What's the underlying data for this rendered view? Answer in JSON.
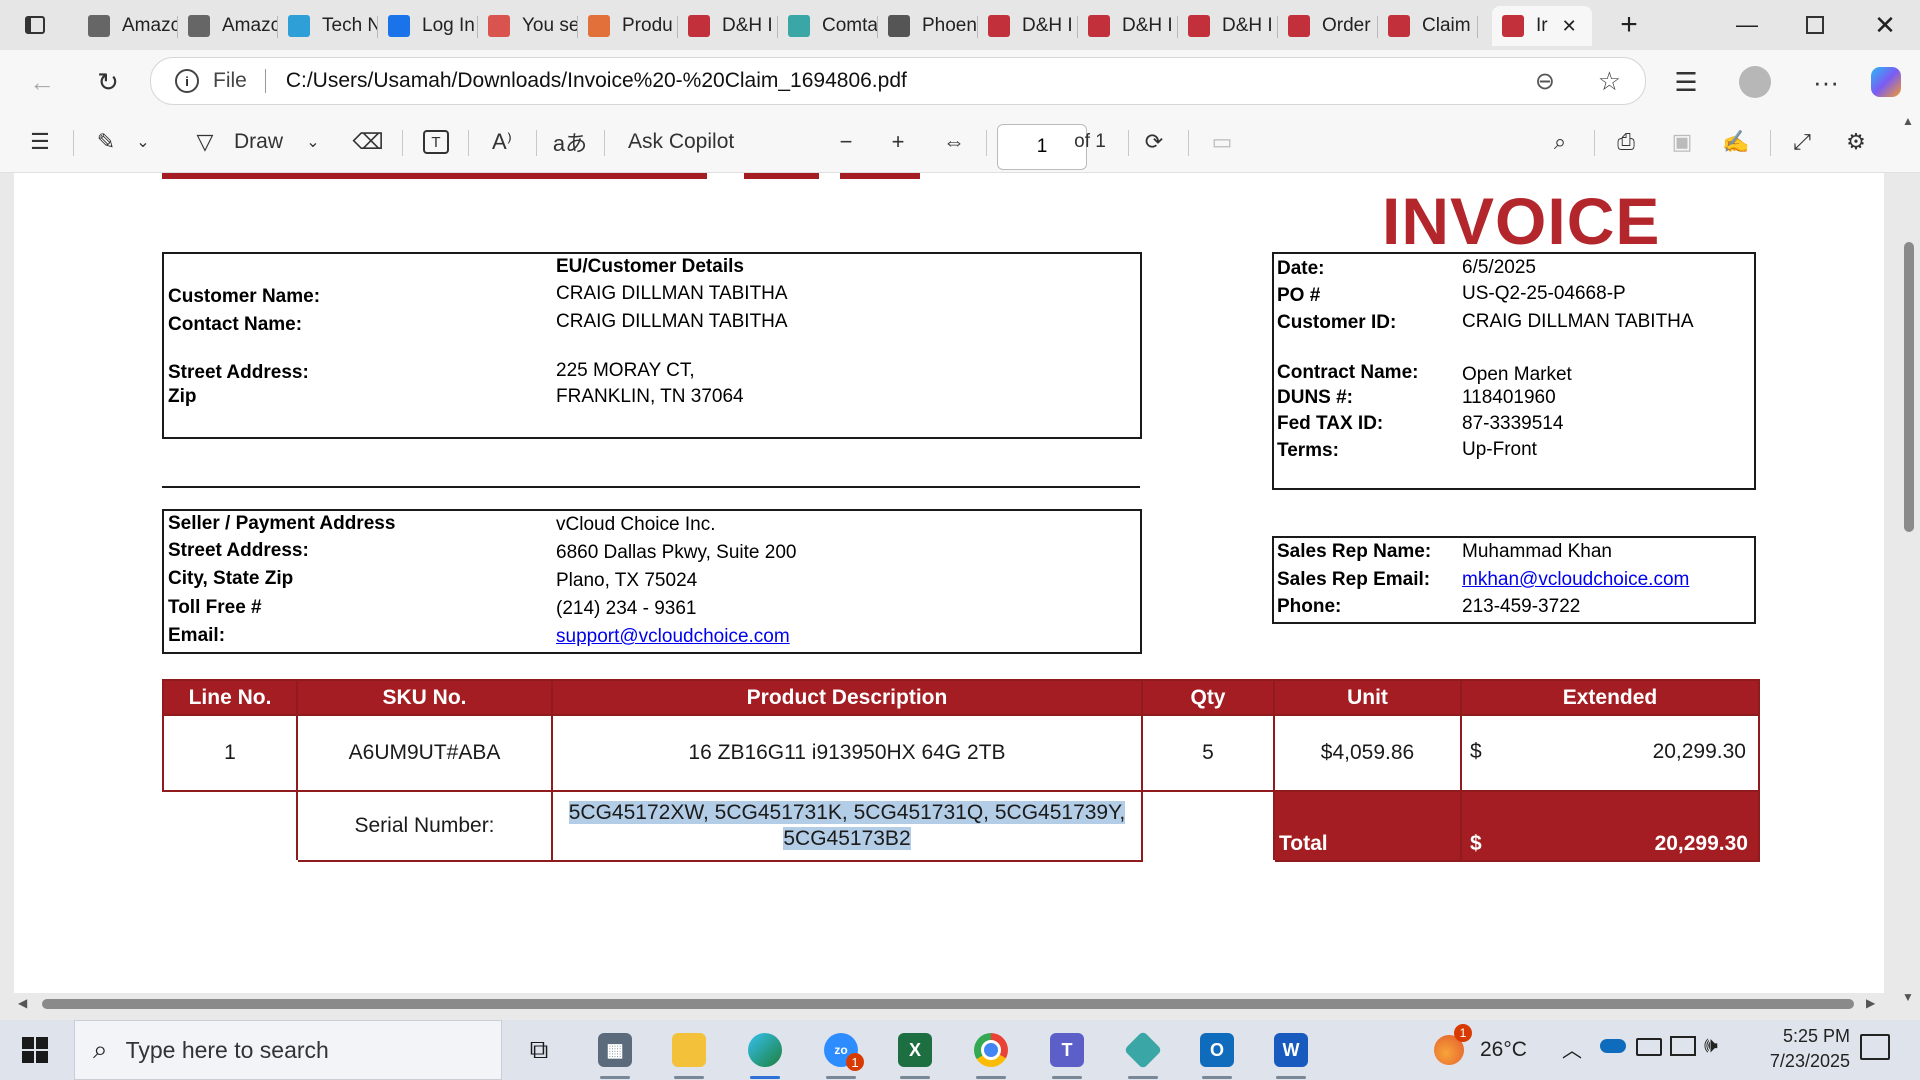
{
  "browser": {
    "tabs": [
      {
        "label": "Amazc",
        "icon": "amazon-icon",
        "color": "#666666"
      },
      {
        "label": "Amazc",
        "icon": "amazon-icon",
        "color": "#666666"
      },
      {
        "label": "Tech N",
        "icon": "ec-icon",
        "color": "#2f9fd8"
      },
      {
        "label": "Log In",
        "icon": "login-icon",
        "color": "#1a73e8"
      },
      {
        "label": "You se",
        "icon": "people-icon",
        "color": "#d9534f"
      },
      {
        "label": "Produ",
        "icon": "product-icon",
        "color": "#e2703a"
      },
      {
        "label": "D&H I",
        "icon": "dh-icon",
        "color": "#c2313b"
      },
      {
        "label": "Comta",
        "icon": "comtan-icon",
        "color": "#3aa6a6"
      },
      {
        "label": "Phoen",
        "icon": "phoenix-icon",
        "color": "#555555"
      },
      {
        "label": "D&H I",
        "icon": "dh-icon",
        "color": "#c2313b"
      },
      {
        "label": "D&H I",
        "icon": "dh-icon",
        "color": "#c2313b"
      },
      {
        "label": "D&H I",
        "icon": "dh-icon",
        "color": "#c2313b"
      },
      {
        "label": "Order",
        "icon": "pdf-icon",
        "color": "#c2313b"
      },
      {
        "label": "Claim",
        "icon": "pdf-icon",
        "color": "#c2313b"
      },
      {
        "label": "Ir",
        "icon": "pdf-icon",
        "color": "#c2313b",
        "active": true
      }
    ],
    "address_prefix": "File",
    "url": "C:/Users/Usamah/Downloads/Invoice%20-%20Claim_1694806.pdf"
  },
  "pdf_toolbar": {
    "draw_label": "Draw",
    "ask_copilot": "Ask Copilot",
    "page_number": "1",
    "page_total": "of 1"
  },
  "invoice": {
    "title": "INVOICE",
    "customer": {
      "header": "EU/Customer Details",
      "customer_name_label": "Customer Name:",
      "customer_name": "CRAIG DILLMAN TABITHA",
      "contact_name_label": "Contact Name:",
      "contact_name": "CRAIG DILLMAN TABITHA",
      "street_label": "Street Address:",
      "street": "225 MORAY CT,",
      "zip_label": "Zip",
      "zip": "FRANKLIN, TN 37064"
    },
    "meta": {
      "date_label": "Date:",
      "date": "6/5/2025",
      "po_label": "PO #",
      "po": "US-Q2-25-04668-P",
      "customer_id_label": "Customer ID:",
      "customer_id": "CRAIG DILLMAN TABITHA",
      "contract_label": "Contract Name:",
      "contract": "Open Market",
      "duns_label": "DUNS #:",
      "duns": "118401960",
      "fedtax_label": "Fed TAX ID:",
      "fedtax": "87-3339514",
      "terms_label": "Terms:",
      "terms": "Up-Front"
    },
    "seller": {
      "header": "Seller / Payment Address",
      "name": "vCloud Choice Inc.",
      "street_label": "Street Address:",
      "street": "6860 Dallas Pkwy, Suite 200",
      "city_label": "City, State Zip",
      "city": "Plano, TX 75024",
      "tollfree_label": "Toll Free #",
      "tollfree": "(214) 234 - 9361",
      "email_label": "Email:",
      "email": "support@vcloudchoice.com"
    },
    "sales_rep": {
      "name_label": "Sales Rep Name:",
      "name": "Muhammad Khan",
      "email_label": "Sales Rep Email:",
      "email": "mkhan@vcloudchoice.com",
      "phone_label": "Phone:",
      "phone": "213-459-3722"
    },
    "table": {
      "headers": [
        "Line No.",
        "SKU No.",
        "Product Description",
        "Qty",
        "Unit",
        "Extended"
      ],
      "row": {
        "line": "1",
        "sku": "A6UM9UT#ABA",
        "description": "16 ZB16G11 i913950HX 64G 2TB",
        "qty": "5",
        "unit": "$4,059.86",
        "ext_currency": "$",
        "extended": "20,299.30"
      },
      "serial_label": "Serial Number:",
      "serial_line1": "5CG45172XW, 5CG451731K, 5CG451731Q, 5CG451739Y,",
      "serial_line2": "5CG45173B2",
      "total_label": "Total",
      "total_currency": "$",
      "total": "20,299.30"
    }
  },
  "taskbar": {
    "search_placeholder": "Type here to search",
    "weather": "26°C",
    "time": "5:25 PM",
    "date": "7/23/2025",
    "zoom_badge": "1",
    "weather_badge": "1"
  }
}
